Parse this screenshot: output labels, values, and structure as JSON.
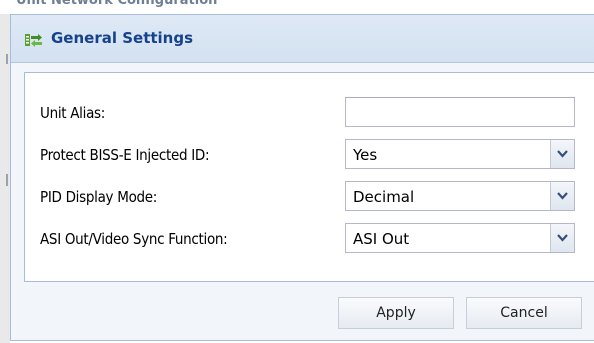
{
  "background": {
    "title": "Unit Network Configuration"
  },
  "dialog": {
    "title": "General Settings",
    "icon": "settings-arrows-icon",
    "accent_color": "#15428b",
    "fields": {
      "unit_alias": {
        "label": "Unit Alias:",
        "value": ""
      },
      "protect_biss": {
        "label": "Protect BISS-E Injected ID:",
        "value": "Yes"
      },
      "pid_display": {
        "label": "PID Display Mode:",
        "value": "Decimal"
      },
      "asi_out": {
        "label": "ASI Out/Video Sync Function:",
        "value": "ASI Out"
      }
    },
    "buttons": {
      "apply": "Apply",
      "cancel": "Cancel"
    }
  }
}
